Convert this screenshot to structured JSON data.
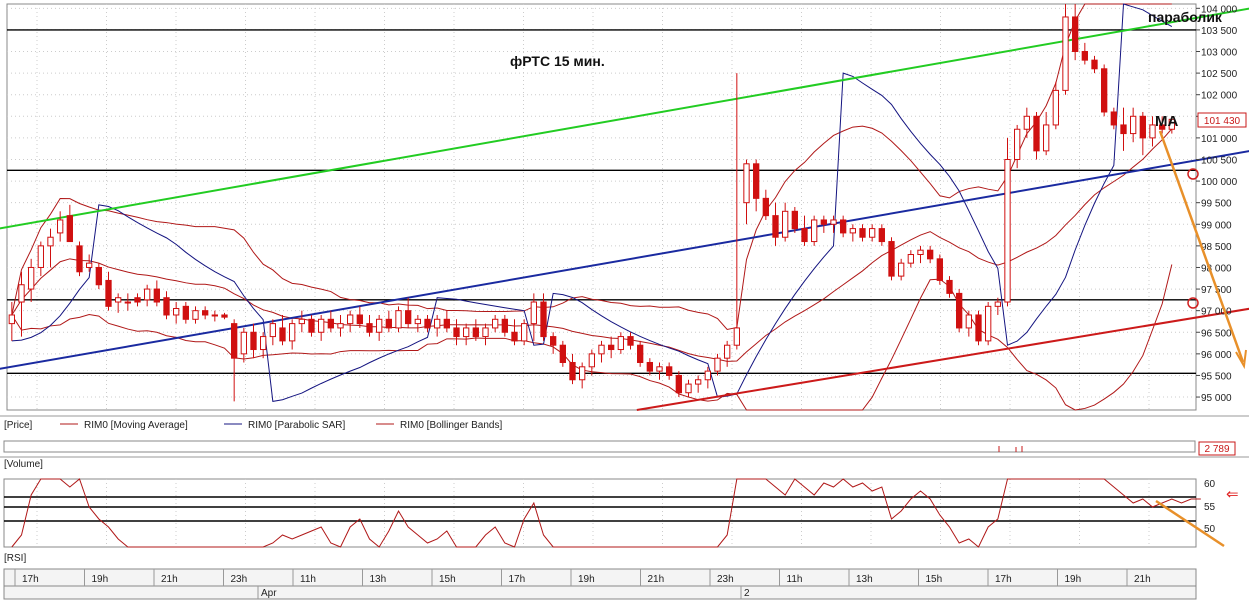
{
  "colors": {
    "candle_up": "#ffffff",
    "candle_down": "#d01010",
    "ma": "#b01818",
    "sar": "#141480",
    "bollinger": "#b01818",
    "trend_green": "#22cc22",
    "trend_blue": "#1a2aa0",
    "trend_red": "#cc1a1a",
    "forecast": "#e8902a",
    "grid": "#cccccc",
    "level": "#000000"
  },
  "annotations": {
    "title": "фРТС   15 мин.",
    "parabolic_label": "параболик",
    "ma_label": "МА"
  },
  "price_panel": {
    "last_price": "101 430",
    "legend": [
      {
        "label": "[Price]"
      },
      {
        "label": "RIM0 [Moving Average]",
        "icon": "red-line"
      },
      {
        "label": "RIM0 [Parabolic SAR]",
        "icon": "blue-line"
      },
      {
        "label": "RIM0 [Bollinger Bands]",
        "icon": "red-line"
      }
    ]
  },
  "volume_panel": {
    "label": "[Volume]",
    "value": "2 789"
  },
  "rsi_panel": {
    "label": "[RSI]",
    "ticks": [
      "60",
      "55",
      "50"
    ],
    "arrow": "⇐"
  },
  "time_axis": {
    "hour_labels": [
      "17h",
      "19h",
      "21h",
      "23h",
      "11h",
      "13h",
      "15h",
      "17h",
      "19h",
      "21h",
      "23h",
      "11h",
      "13h",
      "15h",
      "17h",
      "19h",
      "21h"
    ],
    "date_labels": [
      "Apr",
      "2"
    ]
  },
  "chart_data": {
    "type": "candlestick",
    "instrument": "RIM0",
    "y_ticks": [
      "104 000",
      "103 500",
      "103 000",
      "102 500",
      "102 000",
      "101 500",
      "101 000",
      "100 500",
      "100 000",
      "99 500",
      "99 000",
      "98 500",
      "98 000",
      "97 500",
      "97 000",
      "96 500",
      "96 000",
      "95 500",
      "95 000"
    ],
    "ylim": [
      94700,
      104100
    ],
    "horizontal_levels": [
      103500,
      100250,
      97250,
      95550
    ],
    "candles": [
      {
        "o": 96700,
        "h": 97200,
        "l": 96300,
        "c": 96900
      },
      {
        "o": 97200,
        "h": 97900,
        "l": 96400,
        "c": 97600
      },
      {
        "o": 97500,
        "h": 98200,
        "l": 97200,
        "c": 98000
      },
      {
        "o": 98000,
        "h": 98600,
        "l": 97800,
        "c": 98500
      },
      {
        "o": 98500,
        "h": 98900,
        "l": 98000,
        "c": 98700
      },
      {
        "o": 98800,
        "h": 99300,
        "l": 98600,
        "c": 99100
      },
      {
        "o": 99200,
        "h": 99450,
        "l": 98700,
        "c": 98600
      },
      {
        "o": 98500,
        "h": 98600,
        "l": 97800,
        "c": 97900
      },
      {
        "o": 98000,
        "h": 98300,
        "l": 97900,
        "c": 98100
      },
      {
        "o": 98000,
        "h": 98100,
        "l": 97500,
        "c": 97600
      },
      {
        "o": 97700,
        "h": 97900,
        "l": 97000,
        "c": 97100
      },
      {
        "o": 97200,
        "h": 97400,
        "l": 96950,
        "c": 97300
      },
      {
        "o": 97200,
        "h": 97400,
        "l": 97000,
        "c": 97200
      },
      {
        "o": 97300,
        "h": 97400,
        "l": 97100,
        "c": 97200
      },
      {
        "o": 97250,
        "h": 97600,
        "l": 97100,
        "c": 97500
      },
      {
        "o": 97500,
        "h": 97700,
        "l": 97100,
        "c": 97200
      },
      {
        "o": 97300,
        "h": 97450,
        "l": 96800,
        "c": 96900
      },
      {
        "o": 96900,
        "h": 97200,
        "l": 96700,
        "c": 97050
      },
      {
        "o": 97100,
        "h": 97200,
        "l": 96700,
        "c": 96800
      },
      {
        "o": 96800,
        "h": 97100,
        "l": 96700,
        "c": 97000
      },
      {
        "o": 97000,
        "h": 97100,
        "l": 96800,
        "c": 96900
      },
      {
        "o": 96900,
        "h": 97000,
        "l": 96750,
        "c": 96900
      },
      {
        "o": 96900,
        "h": 96950,
        "l": 96800,
        "c": 96850
      },
      {
        "o": 96700,
        "h": 96800,
        "l": 94900,
        "c": 95900
      },
      {
        "o": 96000,
        "h": 96600,
        "l": 95800,
        "c": 96500
      },
      {
        "o": 96500,
        "h": 96700,
        "l": 95900,
        "c": 96100
      },
      {
        "o": 96100,
        "h": 96500,
        "l": 95900,
        "c": 96400
      },
      {
        "o": 96400,
        "h": 96800,
        "l": 96200,
        "c": 96700
      },
      {
        "o": 96600,
        "h": 96900,
        "l": 96200,
        "c": 96300
      },
      {
        "o": 96300,
        "h": 96800,
        "l": 96100,
        "c": 96700
      },
      {
        "o": 96700,
        "h": 97000,
        "l": 96500,
        "c": 96800
      },
      {
        "o": 96800,
        "h": 96900,
        "l": 96400,
        "c": 96500
      },
      {
        "o": 96500,
        "h": 96900,
        "l": 96300,
        "c": 96800
      },
      {
        "o": 96800,
        "h": 97000,
        "l": 96500,
        "c": 96600
      },
      {
        "o": 96600,
        "h": 96900,
        "l": 96400,
        "c": 96700
      },
      {
        "o": 96700,
        "h": 97000,
        "l": 96500,
        "c": 96900
      },
      {
        "o": 96900,
        "h": 97100,
        "l": 96600,
        "c": 96700
      },
      {
        "o": 96700,
        "h": 96900,
        "l": 96400,
        "c": 96500
      },
      {
        "o": 96500,
        "h": 96900,
        "l": 96300,
        "c": 96800
      },
      {
        "o": 96800,
        "h": 97000,
        "l": 96500,
        "c": 96600
      },
      {
        "o": 96600,
        "h": 97100,
        "l": 96500,
        "c": 97000
      },
      {
        "o": 97000,
        "h": 97300,
        "l": 96600,
        "c": 96700
      },
      {
        "o": 96700,
        "h": 96900,
        "l": 96500,
        "c": 96800
      },
      {
        "o": 96800,
        "h": 96900,
        "l": 96500,
        "c": 96600
      },
      {
        "o": 96600,
        "h": 96900,
        "l": 96400,
        "c": 96800
      },
      {
        "o": 96800,
        "h": 97000,
        "l": 96500,
        "c": 96600
      },
      {
        "o": 96600,
        "h": 96800,
        "l": 96200,
        "c": 96400
      },
      {
        "o": 96400,
        "h": 96700,
        "l": 96200,
        "c": 96600
      },
      {
        "o": 96600,
        "h": 96800,
        "l": 96300,
        "c": 96400
      },
      {
        "o": 96400,
        "h": 96700,
        "l": 96200,
        "c": 96600
      },
      {
        "o": 96600,
        "h": 96900,
        "l": 96500,
        "c": 96800
      },
      {
        "o": 96800,
        "h": 96900,
        "l": 96400,
        "c": 96500
      },
      {
        "o": 96500,
        "h": 96800,
        "l": 96200,
        "c": 96300
      },
      {
        "o": 96300,
        "h": 96800,
        "l": 96200,
        "c": 96700
      },
      {
        "o": 96700,
        "h": 97400,
        "l": 96300,
        "c": 97200
      },
      {
        "o": 97200,
        "h": 97400,
        "l": 96300,
        "c": 96400
      },
      {
        "o": 96400,
        "h": 96500,
        "l": 96000,
        "c": 96200
      },
      {
        "o": 96200,
        "h": 96300,
        "l": 95700,
        "c": 95800
      },
      {
        "o": 95800,
        "h": 96000,
        "l": 95300,
        "c": 95400
      },
      {
        "o": 95400,
        "h": 95800,
        "l": 95200,
        "c": 95700
      },
      {
        "o": 95700,
        "h": 96100,
        "l": 95500,
        "c": 96000
      },
      {
        "o": 96000,
        "h": 96300,
        "l": 95800,
        "c": 96200
      },
      {
        "o": 96200,
        "h": 96400,
        "l": 95900,
        "c": 96100
      },
      {
        "o": 96100,
        "h": 96500,
        "l": 96000,
        "c": 96400
      },
      {
        "o": 96400,
        "h": 96500,
        "l": 96100,
        "c": 96200
      },
      {
        "o": 96200,
        "h": 96300,
        "l": 95700,
        "c": 95800
      },
      {
        "o": 95800,
        "h": 95900,
        "l": 95500,
        "c": 95600
      },
      {
        "o": 95600,
        "h": 95800,
        "l": 95400,
        "c": 95700
      },
      {
        "o": 95700,
        "h": 95800,
        "l": 95400,
        "c": 95500
      },
      {
        "o": 95500,
        "h": 95600,
        "l": 95000,
        "c": 95100
      },
      {
        "o": 95100,
        "h": 95400,
        "l": 95000,
        "c": 95300
      },
      {
        "o": 95300,
        "h": 95500,
        "l": 95100,
        "c": 95400
      },
      {
        "o": 95400,
        "h": 95700,
        "l": 95200,
        "c": 95600
      },
      {
        "o": 95600,
        "h": 96000,
        "l": 95500,
        "c": 95900
      },
      {
        "o": 95900,
        "h": 96300,
        "l": 95700,
        "c": 96200
      },
      {
        "o": 96200,
        "h": 102500,
        "l": 96100,
        "c": 96600
      },
      {
        "o": 99500,
        "h": 100500,
        "l": 99000,
        "c": 100400
      },
      {
        "o": 100400,
        "h": 100500,
        "l": 99300,
        "c": 99600
      },
      {
        "o": 99600,
        "h": 99800,
        "l": 99100,
        "c": 99200
      },
      {
        "o": 99200,
        "h": 99500,
        "l": 98500,
        "c": 98700
      },
      {
        "o": 98700,
        "h": 99500,
        "l": 98600,
        "c": 99300
      },
      {
        "o": 99300,
        "h": 99400,
        "l": 98800,
        "c": 98900
      },
      {
        "o": 98900,
        "h": 99200,
        "l": 98500,
        "c": 98600
      },
      {
        "o": 98600,
        "h": 99200,
        "l": 98500,
        "c": 99100
      },
      {
        "o": 99100,
        "h": 99200,
        "l": 98800,
        "c": 99000
      },
      {
        "o": 99000,
        "h": 99200,
        "l": 98800,
        "c": 99100
      },
      {
        "o": 99100,
        "h": 99200,
        "l": 98700,
        "c": 98800
      },
      {
        "o": 98800,
        "h": 99000,
        "l": 98600,
        "c": 98900
      },
      {
        "o": 98900,
        "h": 99000,
        "l": 98600,
        "c": 98700
      },
      {
        "o": 98700,
        "h": 99000,
        "l": 98600,
        "c": 98900
      },
      {
        "o": 98900,
        "h": 99000,
        "l": 98500,
        "c": 98600
      },
      {
        "o": 98600,
        "h": 98700,
        "l": 97700,
        "c": 97800
      },
      {
        "o": 97800,
        "h": 98200,
        "l": 97700,
        "c": 98100
      },
      {
        "o": 98100,
        "h": 98400,
        "l": 98000,
        "c": 98300
      },
      {
        "o": 98300,
        "h": 98500,
        "l": 98100,
        "c": 98400
      },
      {
        "o": 98400,
        "h": 98500,
        "l": 98100,
        "c": 98200
      },
      {
        "o": 98200,
        "h": 98300,
        "l": 97600,
        "c": 97700
      },
      {
        "o": 97700,
        "h": 97800,
        "l": 97300,
        "c": 97400
      },
      {
        "o": 97400,
        "h": 97500,
        "l": 96500,
        "c": 96600
      },
      {
        "o": 96600,
        "h": 97000,
        "l": 96400,
        "c": 96900
      },
      {
        "o": 96900,
        "h": 97000,
        "l": 96200,
        "c": 96300
      },
      {
        "o": 96300,
        "h": 97200,
        "l": 96200,
        "c": 97100
      },
      {
        "o": 97100,
        "h": 97300,
        "l": 96900,
        "c": 97200
      },
      {
        "o": 97200,
        "h": 101000,
        "l": 97100,
        "c": 100500
      },
      {
        "o": 100500,
        "h": 101300,
        "l": 100300,
        "c": 101200
      },
      {
        "o": 101200,
        "h": 101700,
        "l": 101000,
        "c": 101500
      },
      {
        "o": 101500,
        "h": 101600,
        "l": 100500,
        "c": 100700
      },
      {
        "o": 100700,
        "h": 101600,
        "l": 100600,
        "c": 101300
      },
      {
        "o": 101300,
        "h": 102300,
        "l": 101200,
        "c": 102100
      },
      {
        "o": 102100,
        "h": 104100,
        "l": 102000,
        "c": 103800
      },
      {
        "o": 103800,
        "h": 104100,
        "l": 102800,
        "c": 103000
      },
      {
        "o": 103000,
        "h": 103200,
        "l": 102700,
        "c": 102800
      },
      {
        "o": 102800,
        "h": 102900,
        "l": 102500,
        "c": 102600
      },
      {
        "o": 102600,
        "h": 102700,
        "l": 101500,
        "c": 101600
      },
      {
        "o": 101600,
        "h": 101700,
        "l": 101200,
        "c": 101300
      },
      {
        "o": 101300,
        "h": 101700,
        "l": 100700,
        "c": 101100
      },
      {
        "o": 101100,
        "h": 101700,
        "l": 100900,
        "c": 101500
      },
      {
        "o": 101500,
        "h": 101600,
        "l": 100600,
        "c": 101000
      },
      {
        "o": 101000,
        "h": 101500,
        "l": 100800,
        "c": 101300
      },
      {
        "o": 101300,
        "h": 101500,
        "l": 101100,
        "c": 101200
      },
      {
        "o": 101200,
        "h": 101500,
        "l": 101100,
        "c": 101430
      }
    ],
    "trendlines": [
      {
        "name": "green",
        "from": [
          0,
          98900
        ],
        "to": [
          123,
          104000
        ]
      },
      {
        "name": "blue",
        "from": [
          0,
          95650
        ],
        "to": [
          123,
          100700
        ]
      },
      {
        "name": "red",
        "from": [
          66,
          94700
        ],
        "to": [
          123,
          97050
        ]
      }
    ],
    "rsi": {
      "ylim": [
        45,
        62
      ],
      "levels": [
        57.5,
        55,
        51.5
      ],
      "values": [
        38,
        48,
        58,
        66,
        72,
        65,
        60,
        68,
        55,
        52,
        50,
        47,
        45,
        43,
        42,
        42,
        44,
        40,
        38,
        38,
        39,
        38,
        38,
        33,
        40,
        42,
        44,
        46,
        48,
        47,
        48,
        49,
        50,
        46,
        44,
        50,
        52,
        47,
        45,
        49,
        54,
        50,
        48,
        46,
        47,
        49,
        44,
        42,
        45,
        48,
        50,
        46,
        44,
        52,
        56,
        48,
        44,
        40,
        36,
        38,
        40,
        42,
        41,
        44,
        42,
        38,
        35,
        36,
        34,
        30,
        33,
        36,
        38,
        42,
        48,
        90,
        80,
        72,
        66,
        60,
        58,
        63,
        60,
        58,
        61,
        60,
        62,
        60,
        61,
        59,
        60,
        52,
        54,
        57,
        59,
        57,
        53,
        50,
        46,
        47,
        44,
        50,
        52,
        84,
        82,
        78,
        70,
        72,
        76,
        82,
        74,
        72,
        70,
        66,
        60,
        58,
        56,
        57,
        55,
        56,
        57,
        56,
        57,
        57
      ]
    }
  }
}
